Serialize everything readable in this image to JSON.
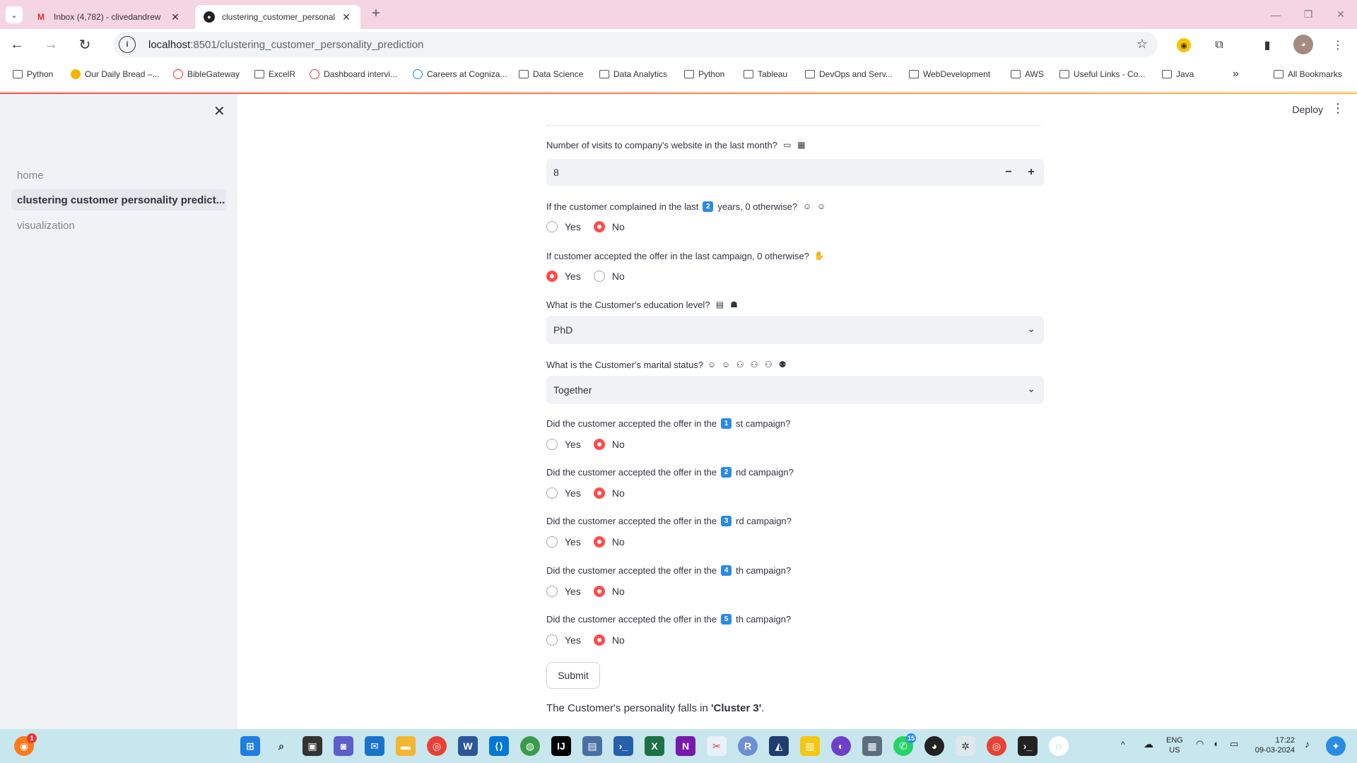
{
  "browser": {
    "tabs": [
      {
        "title": "Inbox (4,782) - clivedandrew",
        "favicon": "gmail-icon",
        "active": false
      },
      {
        "title": "clustering_customer_personality",
        "favicon": "streamlit-icon",
        "active": true
      }
    ],
    "url_host": "localhost",
    "url_path": ":8501/clustering_customer_personality_prediction",
    "bookmarks": [
      {
        "label": "Python",
        "icon": "folder-icon"
      },
      {
        "label": "Our Daily Bread –...",
        "icon": "odb-icon"
      },
      {
        "label": "BibleGateway",
        "icon": "biblegateway-icon"
      },
      {
        "label": "ExcelR",
        "icon": "folder-icon"
      },
      {
        "label": "Dashboard intervi...",
        "icon": "dashboard-icon"
      },
      {
        "label": "Careers at Cogniza...",
        "icon": "cognizant-icon"
      },
      {
        "label": "Data Science",
        "icon": "folder-icon"
      },
      {
        "label": "Data Analytics",
        "icon": "folder-icon"
      },
      {
        "label": "Python",
        "icon": "folder-icon"
      },
      {
        "label": "Tableau",
        "icon": "folder-icon"
      },
      {
        "label": "DevOps and Serv...",
        "icon": "folder-icon"
      },
      {
        "label": "WebDevelopment",
        "icon": "folder-icon"
      },
      {
        "label": "AWS",
        "icon": "folder-icon"
      },
      {
        "label": "Useful Links - Co...",
        "icon": "folder-icon"
      },
      {
        "label": "Java",
        "icon": "folder-icon"
      }
    ],
    "all_bookmarks": "All Bookmarks"
  },
  "sidebar": {
    "items": [
      {
        "label": "home",
        "active": false
      },
      {
        "label": "clustering customer personality predict...",
        "active": true
      },
      {
        "label": "visualization",
        "active": false
      }
    ]
  },
  "header": {
    "deploy_label": "Deploy"
  },
  "form": {
    "visits": {
      "label": "Number of visits to company's website in the last month?",
      "value": "8",
      "minus": "−",
      "plus": "+"
    },
    "complain": {
      "label_before": "If the customer complained in the last",
      "key": "2",
      "label_after": "years, 0 otherwise?",
      "options": [
        "Yes",
        "No"
      ],
      "selected": "No"
    },
    "response": {
      "label": "If customer accepted the offer in the last campaign, 0 otherwise?",
      "options": [
        "Yes",
        "No"
      ],
      "selected": "Yes"
    },
    "education": {
      "label": "What is the Customer's education level?",
      "value": "PhD"
    },
    "marital": {
      "label": "What is the Customer's marital status?",
      "value": "Together"
    },
    "campaigns": [
      {
        "label_before": "Did the customer accepted the offer in the",
        "key": "1",
        "label_after": "st campaign?",
        "options": [
          "Yes",
          "No"
        ],
        "selected": "No"
      },
      {
        "label_before": "Did the customer accepted the offer in the",
        "key": "2",
        "label_after": "nd campaign?",
        "options": [
          "Yes",
          "No"
        ],
        "selected": "No"
      },
      {
        "label_before": "Did the customer accepted the offer in the",
        "key": "3",
        "label_after": "rd campaign?",
        "options": [
          "Yes",
          "No"
        ],
        "selected": "No"
      },
      {
        "label_before": "Did the customer accepted the offer in the",
        "key": "4",
        "label_after": "th campaign?",
        "options": [
          "Yes",
          "No"
        ],
        "selected": "No"
      },
      {
        "label_before": "Did the customer accepted the offer in the",
        "key": "5",
        "label_after": "th campaign?",
        "options": [
          "Yes",
          "No"
        ],
        "selected": "No"
      }
    ],
    "submit_label": "Submit"
  },
  "result": {
    "prefix": "The Customer's personality falls in ",
    "cluster": "'Cluster 3'",
    "suffix": "."
  },
  "taskbar": {
    "lang_top": "ENG",
    "lang_bottom": "US",
    "time": "17:22",
    "date": "09-03-2024",
    "whatsapp_badge": "15",
    "firefox_badge": "1"
  },
  "colors": {
    "accent": "#ff4b4b",
    "sidebar_bg": "#f0f2f6",
    "tabbar_bg": "#f6d5e2",
    "taskbar_bg": "#c8e6ed",
    "keycap_blue": "#2a8be4"
  }
}
